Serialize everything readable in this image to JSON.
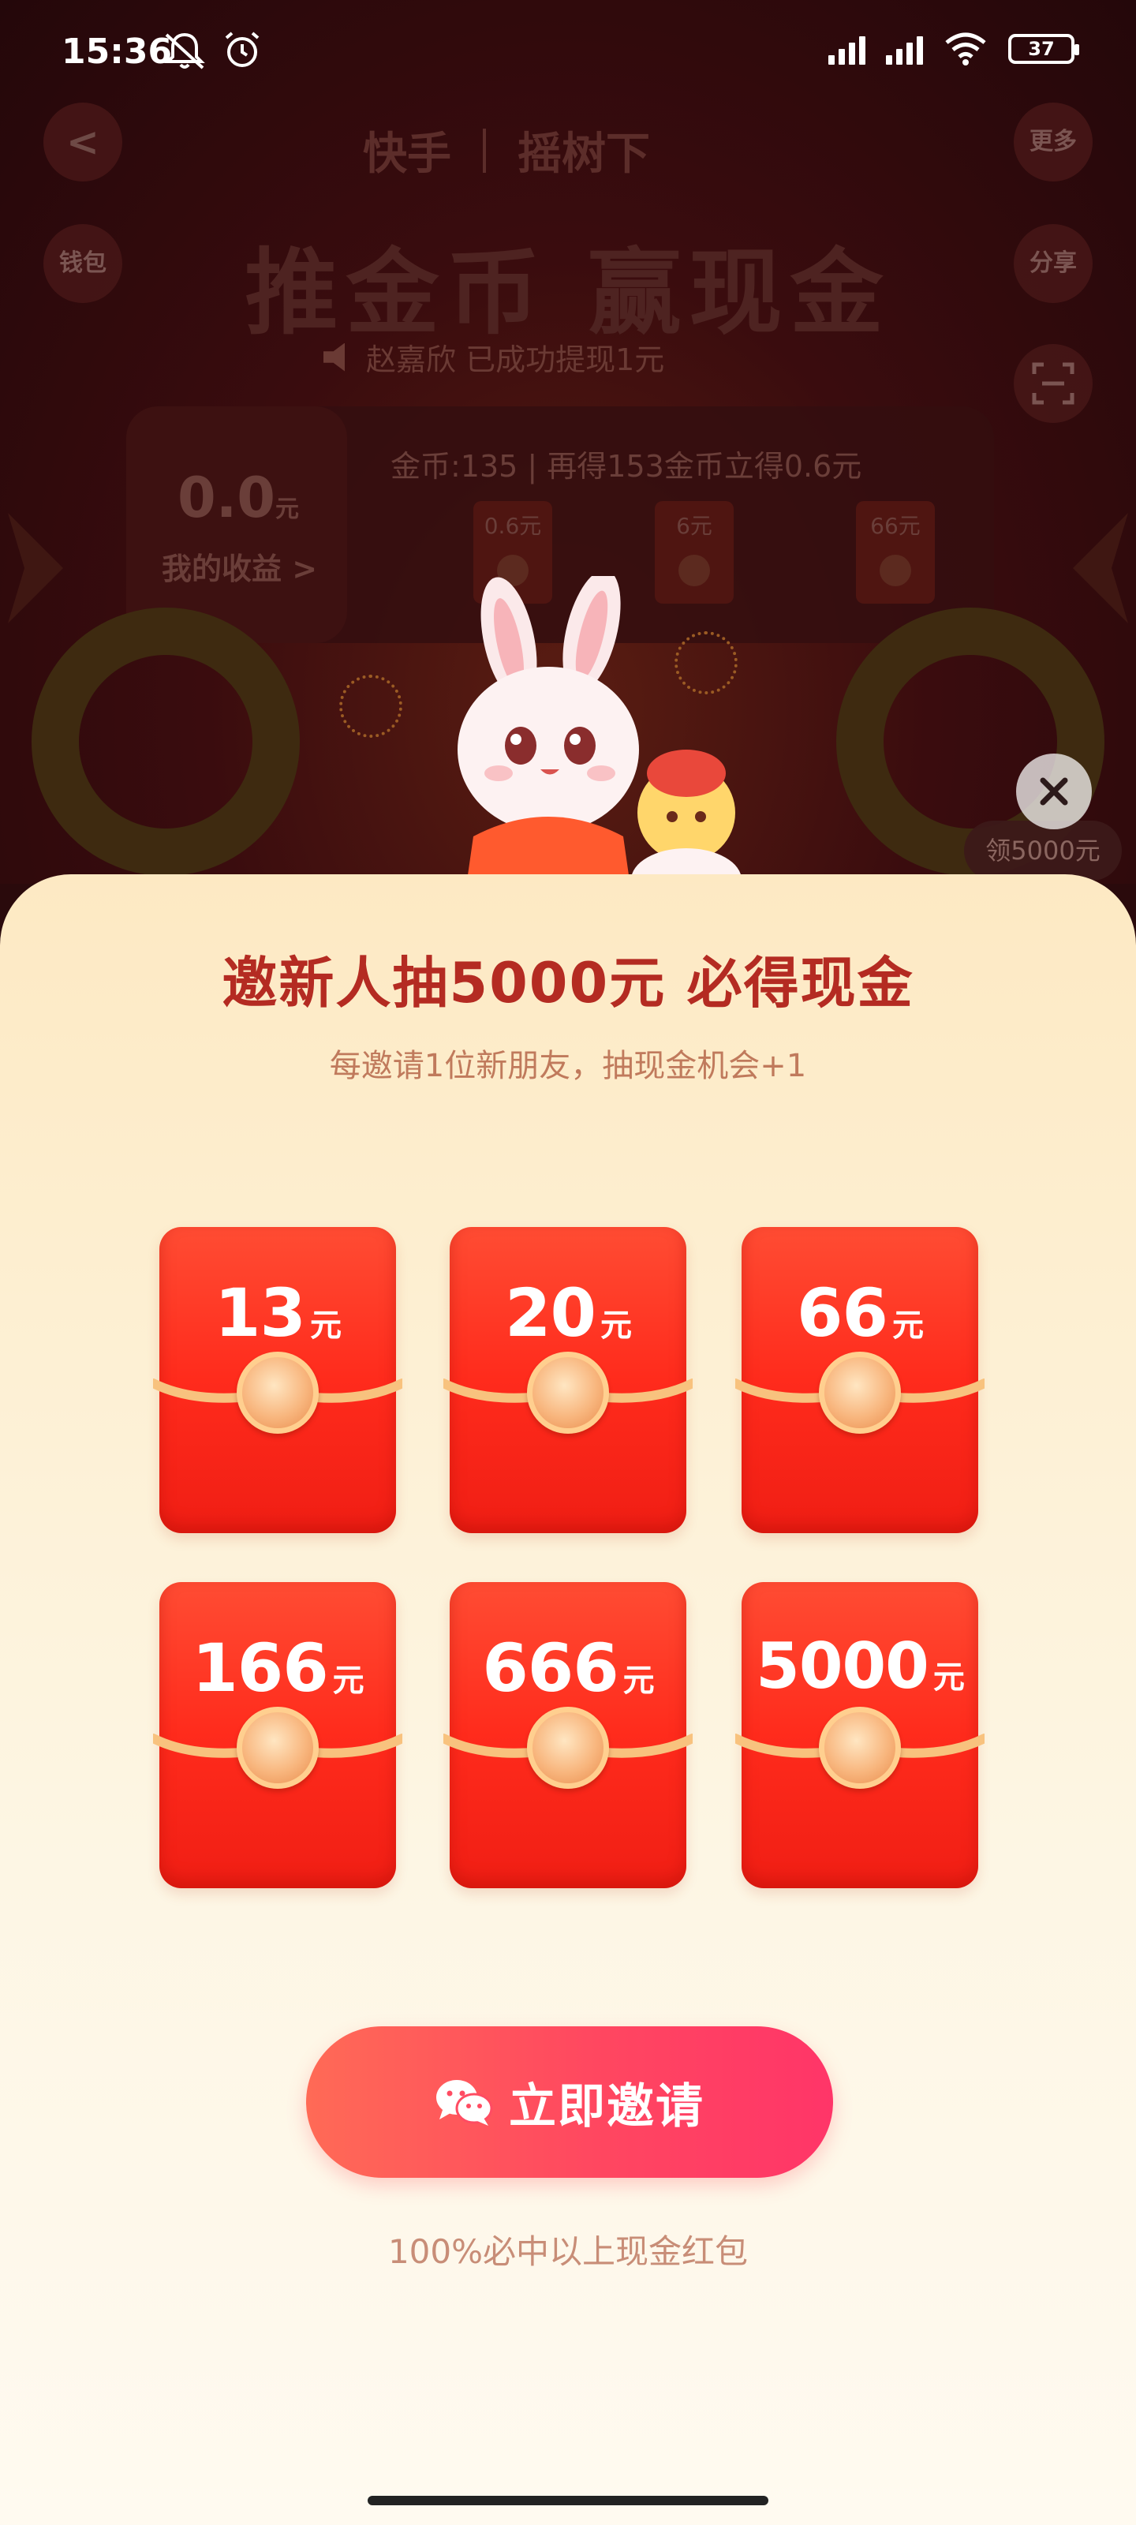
{
  "status_bar": {
    "time": "15:36",
    "battery": "37",
    "icons": [
      "mute-icon",
      "alarm-icon",
      "signal-hd-icon",
      "signal-hd-icon",
      "wifi-icon",
      "battery-icon"
    ]
  },
  "background": {
    "brand_left": "快手",
    "brand_right": "摇树下",
    "back_label": "<",
    "more_label": "更多",
    "wallet_label": "钱包",
    "share_label": "分享",
    "title": "推金币 赢现金",
    "ticker": "赵嘉欣 已成功提现1元",
    "income_value": "0.0",
    "income_unit": "元",
    "income_label": "我的收益 >",
    "coins_line": "金币:135 | 再得153金币立得0.6元",
    "mini_packets": [
      "0.6元",
      "6元",
      "66元"
    ],
    "floater_label": "领5000元"
  },
  "sheet": {
    "title": "邀新人抽5000元 必得现金",
    "subtitle": "每邀请1位新朋友，抽现金机会+1",
    "unit": "元",
    "packets": [
      {
        "amount": "13"
      },
      {
        "amount": "20"
      },
      {
        "amount": "66"
      },
      {
        "amount": "166"
      },
      {
        "amount": "666"
      },
      {
        "amount": "5000"
      }
    ],
    "invite_button": "立即邀请",
    "footnote": "100%必中以上现金红包"
  },
  "colors": {
    "title_red": "#b42b22",
    "packet_red": "#ff2b1c",
    "button_pink": "#ff4760"
  }
}
